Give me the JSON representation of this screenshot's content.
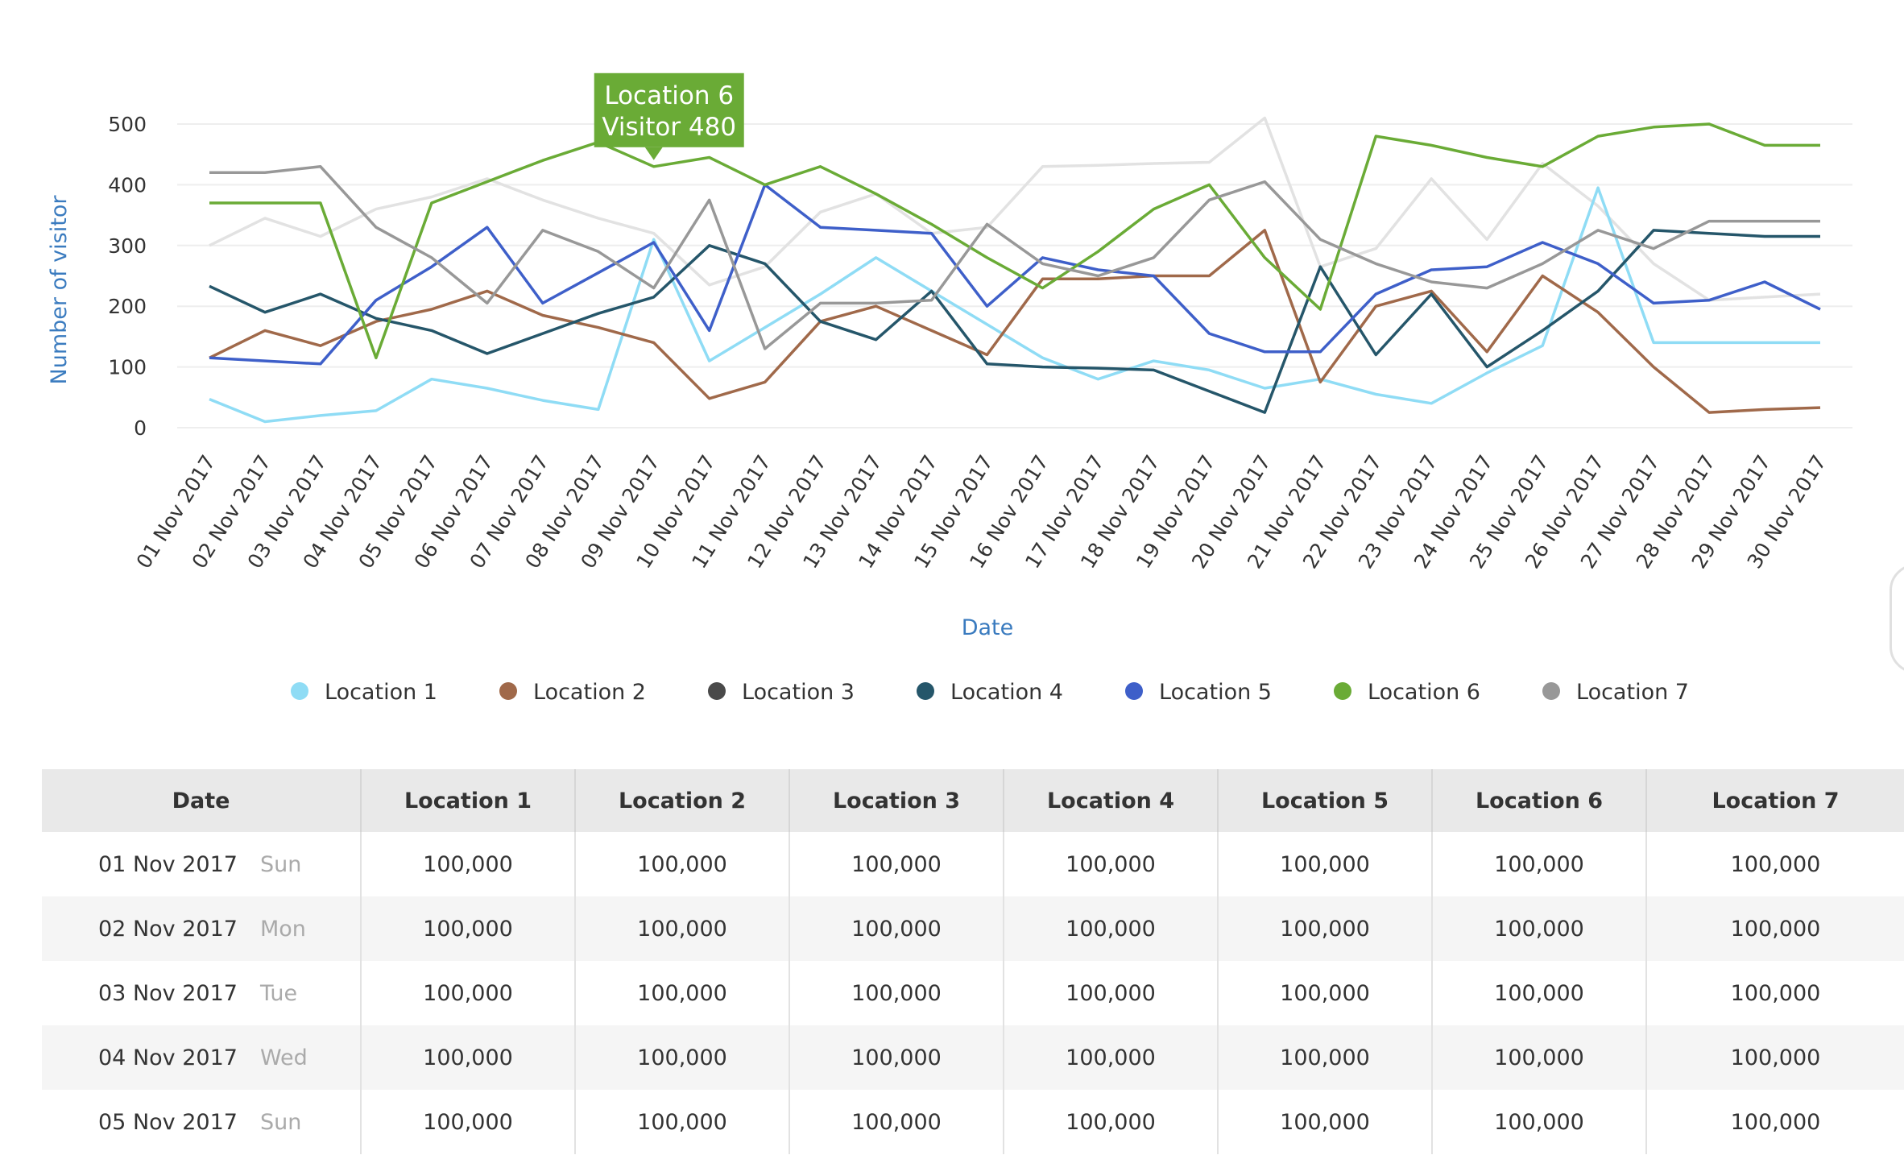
{
  "chart_data": {
    "type": "line",
    "xlabel": "Date",
    "ylabel": "Number of visitor",
    "ylim": [
      0,
      500
    ],
    "yticks": [
      0,
      100,
      200,
      300,
      400,
      500
    ],
    "grid": true,
    "legend_position": "bottom-center",
    "categories": [
      "01 Nov 2017",
      "02 Nov 2017",
      "03 Nov 2017",
      "04 Nov 2017",
      "05 Nov 2017",
      "06 Nov 2017",
      "07 Nov 2017",
      "08 Nov 2017",
      "09 Nov 2017",
      "10 Nov 2017",
      "11 Nov 2017",
      "12 Nov 2017",
      "13 Nov 2017",
      "14 Nov 2017",
      "15 Nov 2017",
      "16 Nov 2017",
      "17 Nov 2017",
      "18 Nov 2017",
      "19 Nov 2017",
      "20 Nov 2017",
      "21 Nov 2017",
      "22 Nov 2017",
      "23 Nov 2017",
      "24 Nov 2017",
      "25 Nov 2017",
      "26 Nov 2017",
      "27 Nov 2017",
      "28 Nov 2017",
      "29 Nov 2017",
      "30 Nov 2017"
    ],
    "background_series": {
      "color": "#e2e2e2",
      "values": [
        300,
        345,
        315,
        360,
        380,
        410,
        375,
        345,
        320,
        235,
        265,
        355,
        385,
        320,
        330,
        430,
        432,
        435,
        437,
        510,
        265,
        295,
        410,
        310,
        435,
        365,
        270,
        210,
        215,
        220
      ]
    },
    "series": [
      {
        "name": "Location 1",
        "color": "#8fdcf5",
        "values": [
          47,
          10,
          20,
          28,
          80,
          65,
          45,
          30,
          310,
          110,
          165,
          220,
          280,
          225,
          170,
          115,
          80,
          110,
          95,
          65,
          80,
          55,
          40,
          90,
          135,
          395,
          140,
          140,
          140,
          140
        ]
      },
      {
        "name": "Location 2",
        "color": "#a0694a",
        "values": [
          115,
          160,
          135,
          175,
          195,
          225,
          185,
          165,
          140,
          48,
          75,
          175,
          200,
          160,
          120,
          245,
          245,
          250,
          250,
          325,
          75,
          200,
          225,
          125,
          250,
          190,
          100,
          25,
          30,
          33
        ]
      },
      {
        "name": "Location 3",
        "color": "#4a4a4a",
        "values": [
          null,
          null,
          null,
          null,
          null,
          null,
          null,
          null,
          null,
          null,
          null,
          null,
          null,
          null,
          null,
          null,
          null,
          null,
          null,
          null,
          null,
          null,
          null,
          null,
          null,
          null,
          null,
          null,
          null,
          null
        ]
      },
      {
        "name": "Location 4",
        "color": "#25566a",
        "values": [
          233,
          190,
          220,
          180,
          160,
          122,
          155,
          188,
          215,
          300,
          270,
          175,
          145,
          225,
          105,
          100,
          98,
          95,
          60,
          25,
          265,
          120,
          220,
          100,
          160,
          225,
          325,
          320,
          315,
          315
        ]
      },
      {
        "name": "Location 5",
        "color": "#3e5fc9",
        "values": [
          115,
          110,
          105,
          210,
          265,
          330,
          205,
          255,
          305,
          160,
          400,
          330,
          325,
          320,
          200,
          280,
          260,
          250,
          155,
          125,
          125,
          220,
          260,
          265,
          305,
          270,
          205,
          210,
          240,
          195
        ]
      },
      {
        "name": "Location 6",
        "color": "#6aab36",
        "values": [
          370,
          370,
          370,
          115,
          370,
          405,
          440,
          470,
          430,
          445,
          400,
          430,
          385,
          335,
          280,
          230,
          290,
          360,
          400,
          280,
          195,
          480,
          465,
          445,
          430,
          480,
          495,
          500,
          465,
          465
        ]
      },
      {
        "name": "Location 7",
        "color": "#989898",
        "values": [
          420,
          420,
          430,
          330,
          280,
          205,
          325,
          290,
          230,
          375,
          130,
          205,
          205,
          210,
          335,
          270,
          250,
          280,
          375,
          405,
          310,
          270,
          240,
          230,
          270,
          325,
          295,
          340,
          340,
          340
        ]
      }
    ]
  },
  "tooltip": {
    "series_index": 5,
    "category_index": 8,
    "line1": "Location 6",
    "line2": "Visitor 480",
    "color": "#6aab36"
  },
  "table": {
    "headers": [
      "Date",
      "Location 1",
      "Location 2",
      "Location 3",
      "Location 4",
      "Location 5",
      "Location 6",
      "Location 7"
    ],
    "rows": [
      {
        "date": "01 Nov 2017",
        "weekday": "Sun",
        "values": [
          "100,000",
          "100,000",
          "100,000",
          "100,000",
          "100,000",
          "100,000",
          "100,000"
        ]
      },
      {
        "date": "02 Nov 2017",
        "weekday": "Mon",
        "values": [
          "100,000",
          "100,000",
          "100,000",
          "100,000",
          "100,000",
          "100,000",
          "100,000"
        ]
      },
      {
        "date": "03 Nov 2017",
        "weekday": "Tue",
        "values": [
          "100,000",
          "100,000",
          "100,000",
          "100,000",
          "100,000",
          "100,000",
          "100,000"
        ]
      },
      {
        "date": "04 Nov 2017",
        "weekday": "Wed",
        "values": [
          "100,000",
          "100,000",
          "100,000",
          "100,000",
          "100,000",
          "100,000",
          "100,000"
        ]
      },
      {
        "date": "05 Nov 2017",
        "weekday": "Sun",
        "values": [
          "100,000",
          "100,000",
          "100,000",
          "100,000",
          "100,000",
          "100,000",
          "100,000"
        ]
      }
    ]
  }
}
